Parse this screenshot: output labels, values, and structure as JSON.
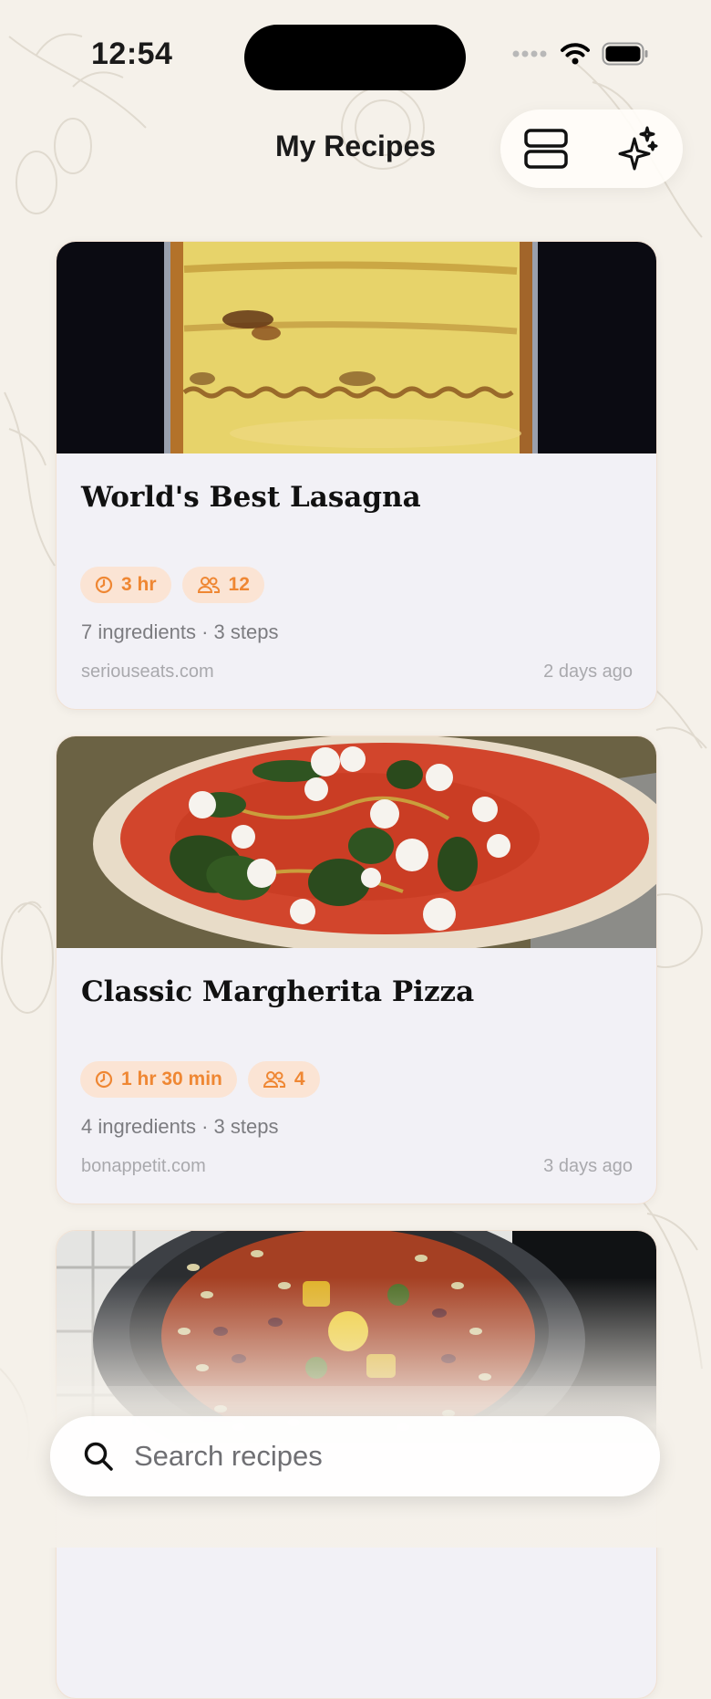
{
  "status_bar": {
    "time": "12:54"
  },
  "header": {
    "title": "My Recipes"
  },
  "recipes": [
    {
      "title": "World's Best Lasagna",
      "time": "3 hr",
      "servings": "12",
      "summary": "7 ingredients · 3 steps",
      "source": "seriouseats.com",
      "added": "2 days ago"
    },
    {
      "title": "Classic Margherita Pizza",
      "time": "1 hr 30 min",
      "servings": "4",
      "summary": "4 ingredients · 3 steps",
      "source": "bonappetit.com",
      "added": "3 days ago"
    }
  ],
  "search": {
    "placeholder": "Search recipes"
  },
  "colors": {
    "accent": "#ef8733",
    "chip_bg": "#fbe4d4",
    "card_bg": "#f2f1f6",
    "page_bg": "#f5f1ea"
  },
  "icons": [
    "layout-toggle-icon",
    "sparkles-icon",
    "clock-icon",
    "people-icon",
    "search-icon"
  ]
}
